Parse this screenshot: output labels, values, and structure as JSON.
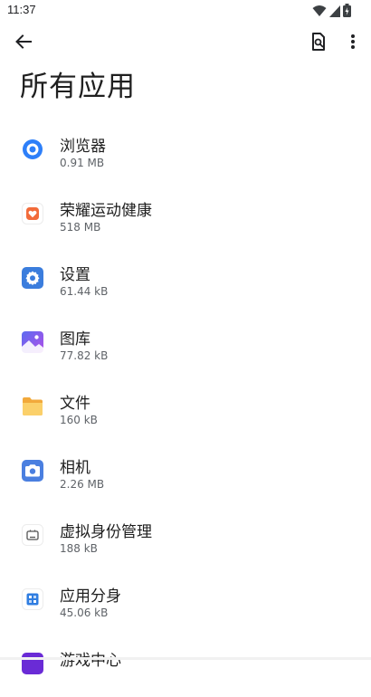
{
  "status_bar": {
    "time": "11:37",
    "icons": [
      "wifi-icon",
      "signal-icon",
      "battery-icon"
    ]
  },
  "toolbar": {
    "back_icon": "arrow-left-icon",
    "search_icon": "search-document-icon",
    "more_icon": "more-vertical-icon"
  },
  "page": {
    "title": "所有应用"
  },
  "apps": [
    {
      "name": "浏览器",
      "size": "0.91 MB",
      "icon": "browser-icon",
      "color": "#2d7ff9"
    },
    {
      "name": "荣耀运动健康",
      "size": "518 MB",
      "icon": "health-icon",
      "color": "#f26b3a"
    },
    {
      "name": "设置",
      "size": "61.44 kB",
      "icon": "settings-icon",
      "color": "#3b7ddd"
    },
    {
      "name": "图库",
      "size": "77.82 kB",
      "icon": "gallery-icon",
      "color": "#8b5cf6"
    },
    {
      "name": "文件",
      "size": "160 kB",
      "icon": "folder-icon",
      "color": "#f5b73b"
    },
    {
      "name": "相机",
      "size": "2.26 MB",
      "icon": "camera-icon",
      "color": "#4a7fe0"
    },
    {
      "name": "虚拟身份管理",
      "size": "188 kB",
      "icon": "virtual-identity-icon",
      "color": "#6b6b6b"
    },
    {
      "name": "应用分身",
      "size": "45.06 kB",
      "icon": "app-clone-icon",
      "color": "#2f7de1"
    },
    {
      "name": "游戏中心",
      "size": "",
      "icon": "game-center-icon",
      "color": "#6a2bd6"
    }
  ]
}
